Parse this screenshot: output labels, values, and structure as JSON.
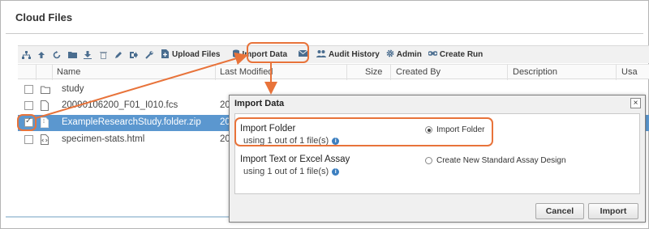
{
  "panel": {
    "title": "Cloud Files"
  },
  "toolbar": {
    "icons": [
      "sitemap-icon",
      "upload-arrow-icon",
      "refresh-icon",
      "new-folder-icon",
      "download-icon",
      "delete-icon",
      "edit-icon",
      "move-icon",
      "wrench-icon"
    ],
    "upload_label": "Upload Files",
    "import_label": "Import Data",
    "audit_label": "Audit History",
    "admin_label": "Admin",
    "create_run_label": "Create Run"
  },
  "grid": {
    "columns": [
      "Name",
      "Last Modified",
      "Size",
      "Created By",
      "Description",
      "Usa"
    ],
    "rows": [
      {
        "name": "study",
        "date": "",
        "checked": false,
        "selected": false,
        "type": "folder"
      },
      {
        "name": "20090106200_F01_I010.fcs",
        "date": "20",
        "checked": false,
        "selected": false,
        "type": "file"
      },
      {
        "name": "ExampleResearchStudy.folder.zip",
        "date": "20",
        "checked": true,
        "selected": true,
        "type": "zip"
      },
      {
        "name": "specimen-stats.html",
        "date": "20",
        "checked": false,
        "selected": false,
        "type": "html"
      }
    ]
  },
  "dialog": {
    "title": "Import Data",
    "close": "×",
    "option1": {
      "title": "Import Folder",
      "sub": "using 1 out of 1 file(s)",
      "radio": "Import Folder",
      "checked": true
    },
    "option2": {
      "title": "Import Text or Excel Assay",
      "sub": "using 1 out of 1 file(s)",
      "radio": "Create New Standard Assay Design",
      "checked": false
    },
    "info": "i",
    "cancel": "Cancel",
    "import": "Import"
  },
  "colors": {
    "highlight": "#e8733a",
    "selection": "#5b97cf",
    "icon": "#4a6d8f"
  }
}
